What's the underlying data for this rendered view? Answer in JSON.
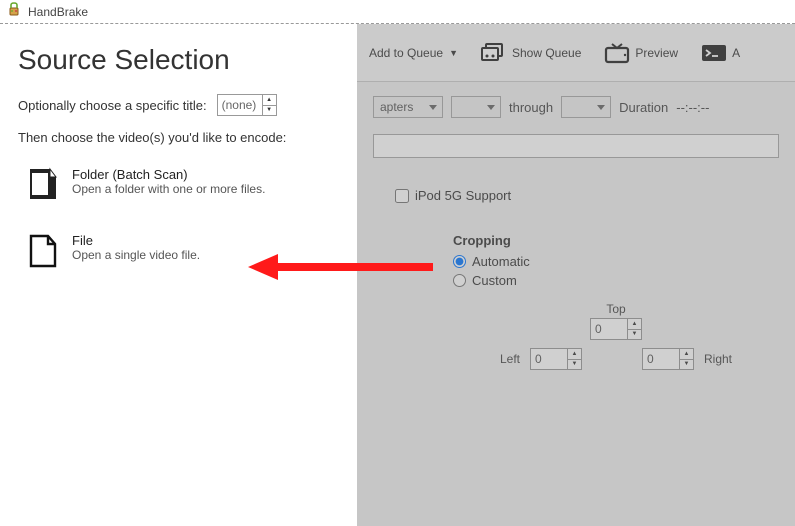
{
  "app": {
    "title": "HandBrake"
  },
  "source": {
    "heading": "Source Selection",
    "optional_label": "Optionally choose a specific title:",
    "title_value": "(none)",
    "instruction": "Then choose the video(s) you'd like to encode:",
    "folder": {
      "title": "Folder (Batch Scan)",
      "sub": "Open a folder with one or more files."
    },
    "file": {
      "title": "File",
      "sub": "Open a single video file."
    }
  },
  "toolbar": {
    "add_queue": "Add to Queue",
    "show_queue": "Show Queue",
    "preview": "Preview",
    "activity_letter": "A"
  },
  "range": {
    "chapters_label": "apters",
    "through": "through",
    "duration_label": "Duration",
    "duration_value": "--:--:--"
  },
  "ipod": {
    "label": "iPod 5G Support"
  },
  "crop": {
    "heading": "Cropping",
    "auto": "Automatic",
    "custom": "Custom",
    "top": "Top",
    "left": "Left",
    "right": "Right",
    "val_top": "0",
    "val_left": "0",
    "val_right": "0"
  }
}
